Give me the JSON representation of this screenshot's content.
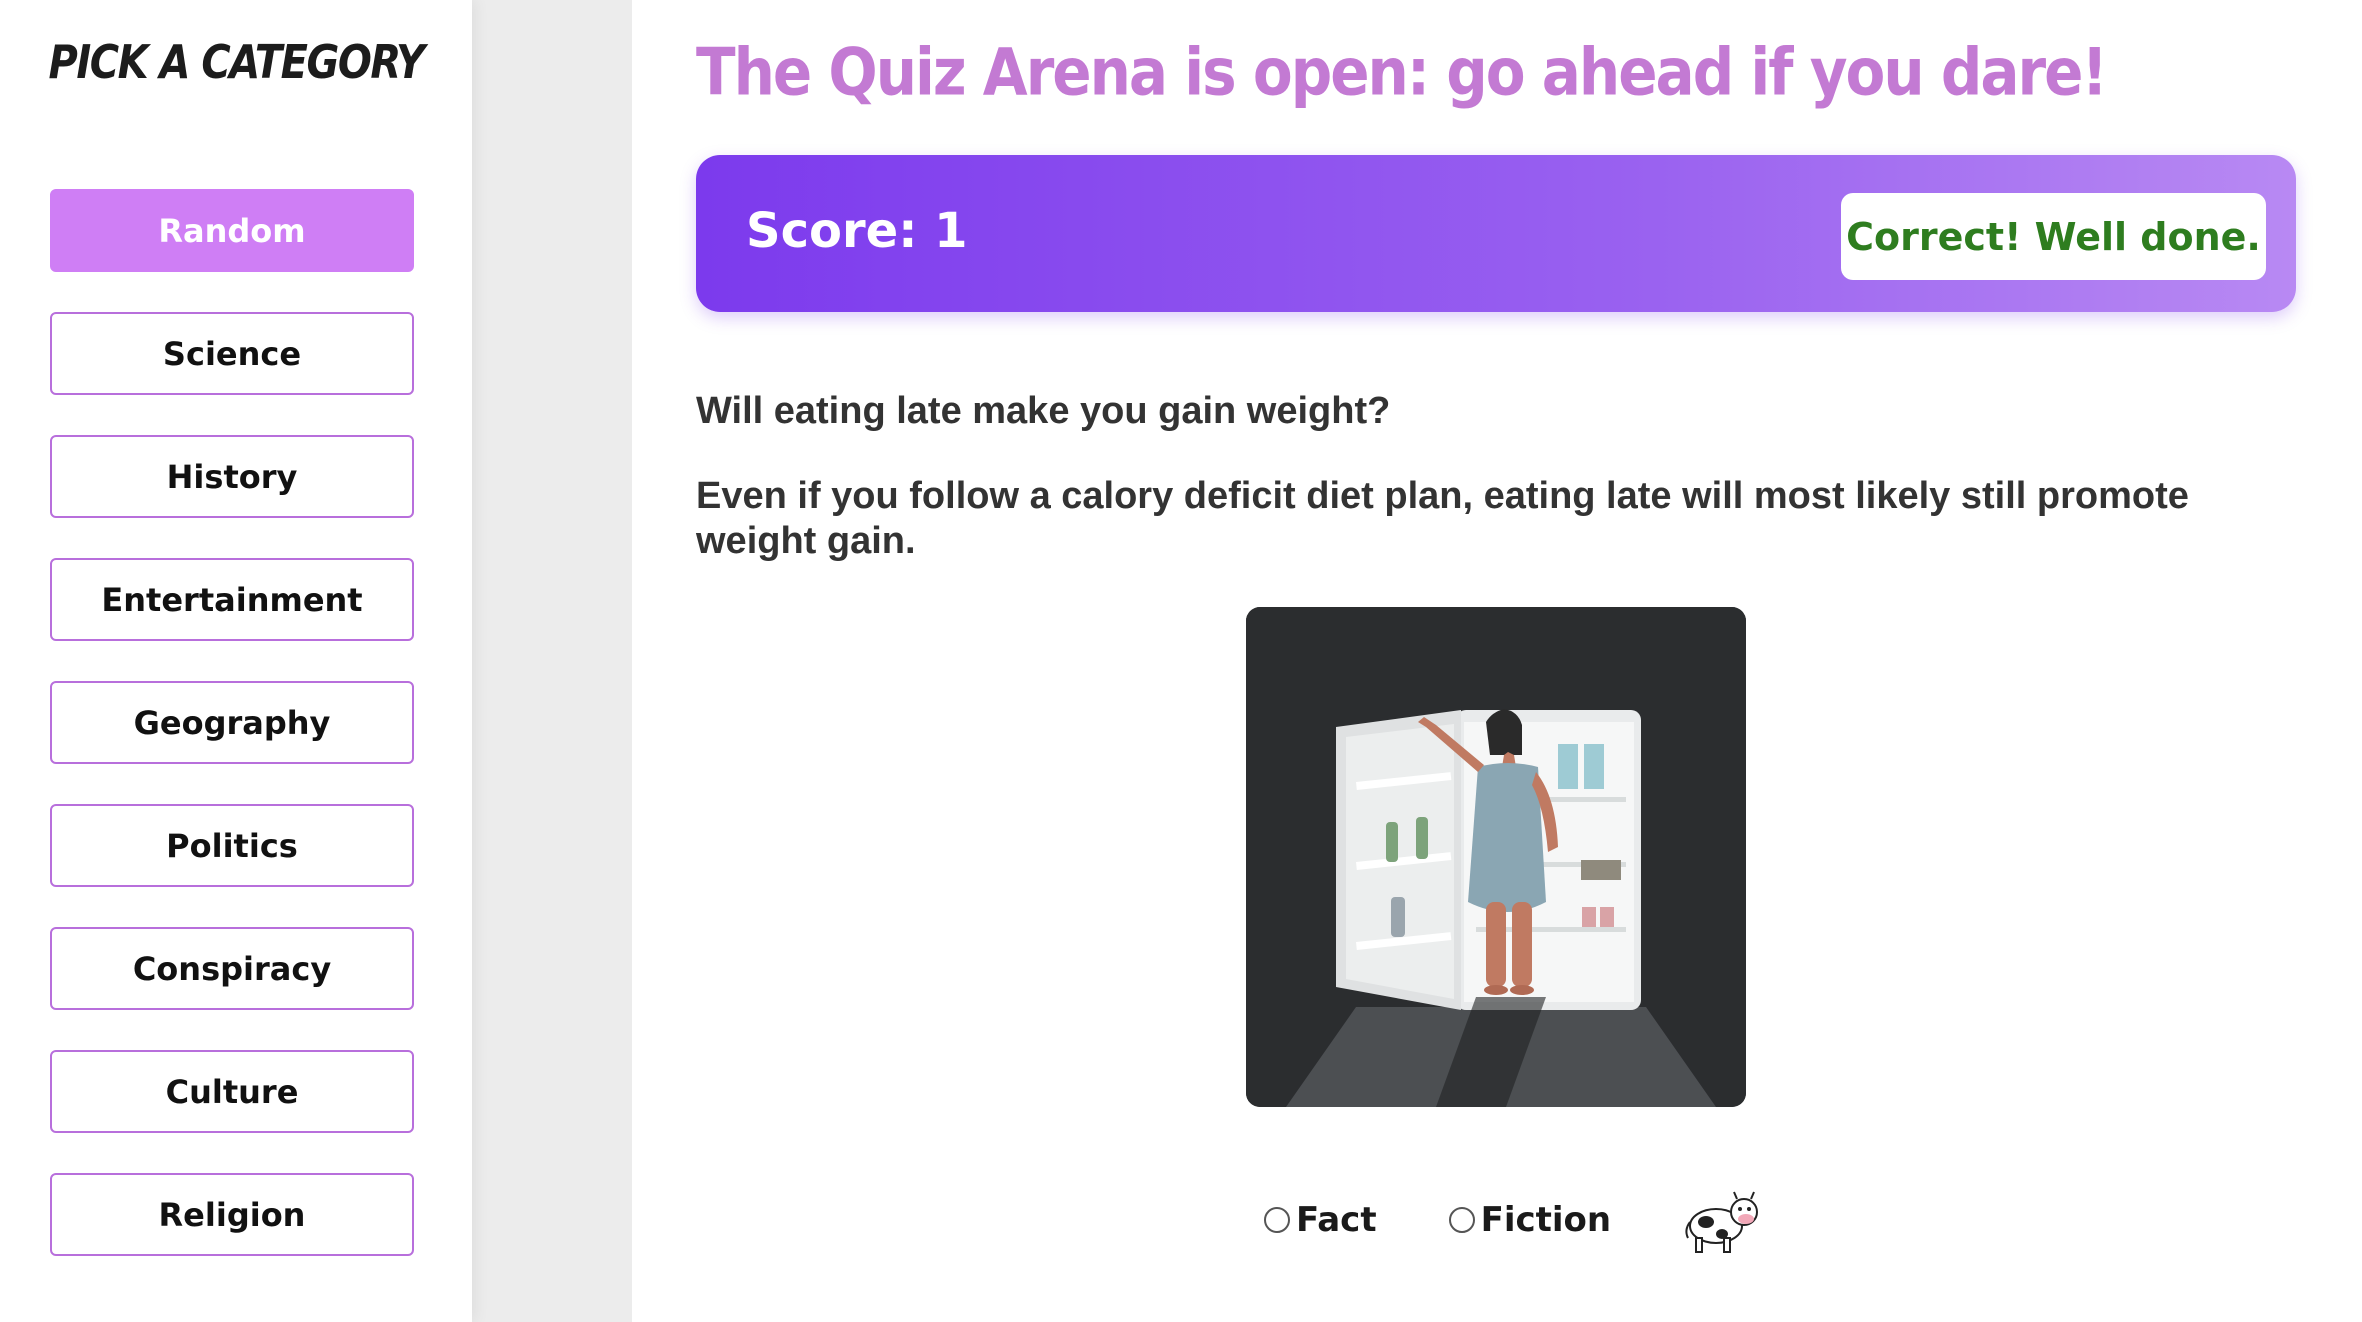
{
  "sidebar": {
    "title": "PICK A CATEGORY",
    "categories": [
      {
        "label": "Random",
        "active": true
      },
      {
        "label": "Science"
      },
      {
        "label": "History"
      },
      {
        "label": "Entertainment"
      },
      {
        "label": "Geography"
      },
      {
        "label": "Politics"
      },
      {
        "label": "Conspiracy"
      },
      {
        "label": "Culture"
      },
      {
        "label": "Religion"
      }
    ]
  },
  "main": {
    "headline": "The Quiz Arena is open: go ahead if you dare!",
    "score_label": "Score: 1",
    "feedback": "Correct! Well done.",
    "question": "Will eating late make you gain weight?",
    "statement": "Even if you follow a calory deficit diet plan, eating late will most likely still promote weight gain.",
    "answers": {
      "fact": "Fact",
      "fiction": "Fiction"
    }
  },
  "colors": {
    "accent": "#cf7ef5",
    "headline": "#c37ad3",
    "score_gradient_start": "#7c3aed",
    "score_gradient_end": "#b889f3",
    "feedback_text": "#2e7d1f"
  },
  "icons": {
    "mascot": "cow-icon"
  }
}
